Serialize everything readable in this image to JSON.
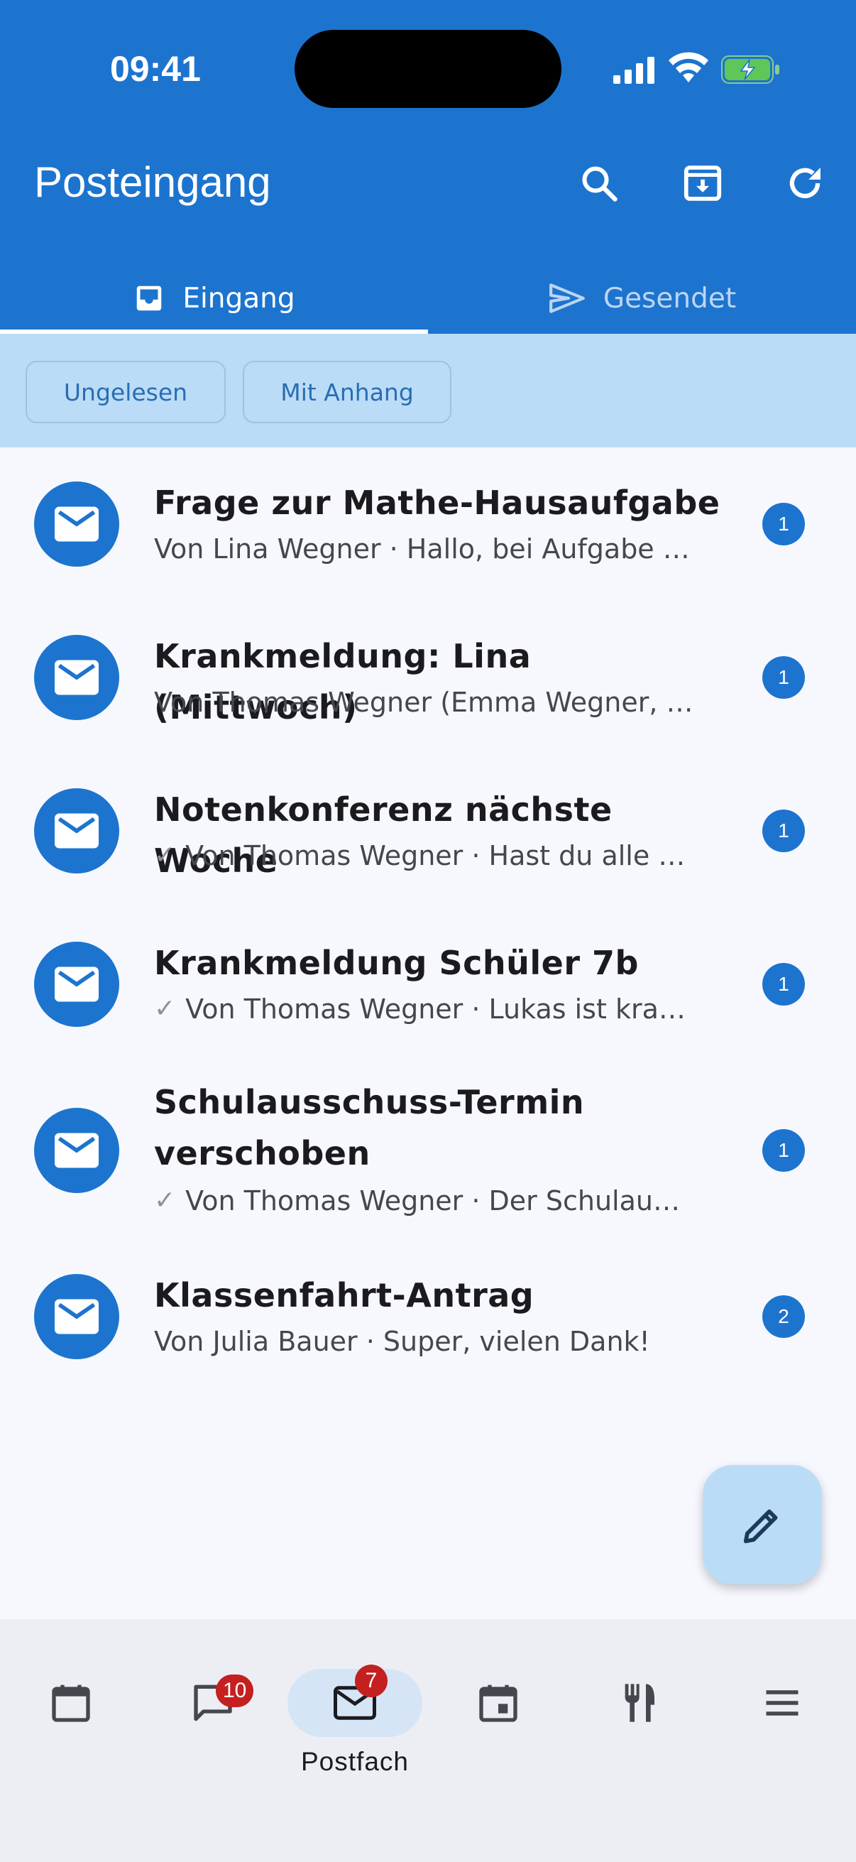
{
  "status_bar": {
    "time": "09:41"
  },
  "app_bar": {
    "title": "Posteingang",
    "icons": [
      "search-icon",
      "archive-download-icon",
      "refresh-icon"
    ]
  },
  "tabs": [
    {
      "label": "Eingang",
      "icon": "inbox-icon",
      "active": true
    },
    {
      "label": "Gesendet",
      "icon": "send-icon",
      "active": false
    }
  ],
  "filters": [
    {
      "label": "Ungelesen"
    },
    {
      "label": "Mit Anhang"
    }
  ],
  "messages": [
    {
      "subject": "Frage zur Mathe-Hausaufgabe",
      "preview": "Von Lina Wegner · Hallo, bei Aufgabe …",
      "read_tick": false,
      "count": "1"
    },
    {
      "subject": "Krankmeldung: Lina (Mittwoch)",
      "preview": "Von Thomas Wegner (Emma Wegner, …",
      "read_tick": false,
      "count": "1"
    },
    {
      "subject": "Notenkonferenz nächste Woche",
      "preview": "Von Thomas Wegner · Hast du alle …",
      "read_tick": true,
      "count": "1"
    },
    {
      "subject": "Krankmeldung Schüler 7b",
      "preview": "Von Thomas Wegner · Lukas ist kra…",
      "read_tick": true,
      "count": "1"
    },
    {
      "subject": "Schulausschuss-Termin verschoben",
      "preview": "Von Thomas Wegner · Der Schulau…",
      "read_tick": true,
      "count": "1"
    },
    {
      "subject": "Klassenfahrt-Antrag",
      "preview": "Von Julia Bauer · Super, vielen Dank!",
      "read_tick": false,
      "count": "2"
    }
  ],
  "fab": {
    "icon": "edit-pencil-icon"
  },
  "bottom_nav": {
    "items": [
      {
        "icon": "calendar-icon",
        "label": "",
        "badge": ""
      },
      {
        "icon": "chat-icon",
        "label": "",
        "badge": "10"
      },
      {
        "icon": "mail-icon",
        "label": "Postfach",
        "badge": "7",
        "active": true
      },
      {
        "icon": "event-icon",
        "label": "",
        "badge": ""
      },
      {
        "icon": "restaurant-icon",
        "label": "",
        "badge": ""
      },
      {
        "icon": "menu-icon",
        "label": "",
        "badge": ""
      }
    ]
  },
  "colors": {
    "primary": "#1c74cf",
    "filter_bg": "#bbdcf7",
    "badge_red": "#c4201f"
  }
}
